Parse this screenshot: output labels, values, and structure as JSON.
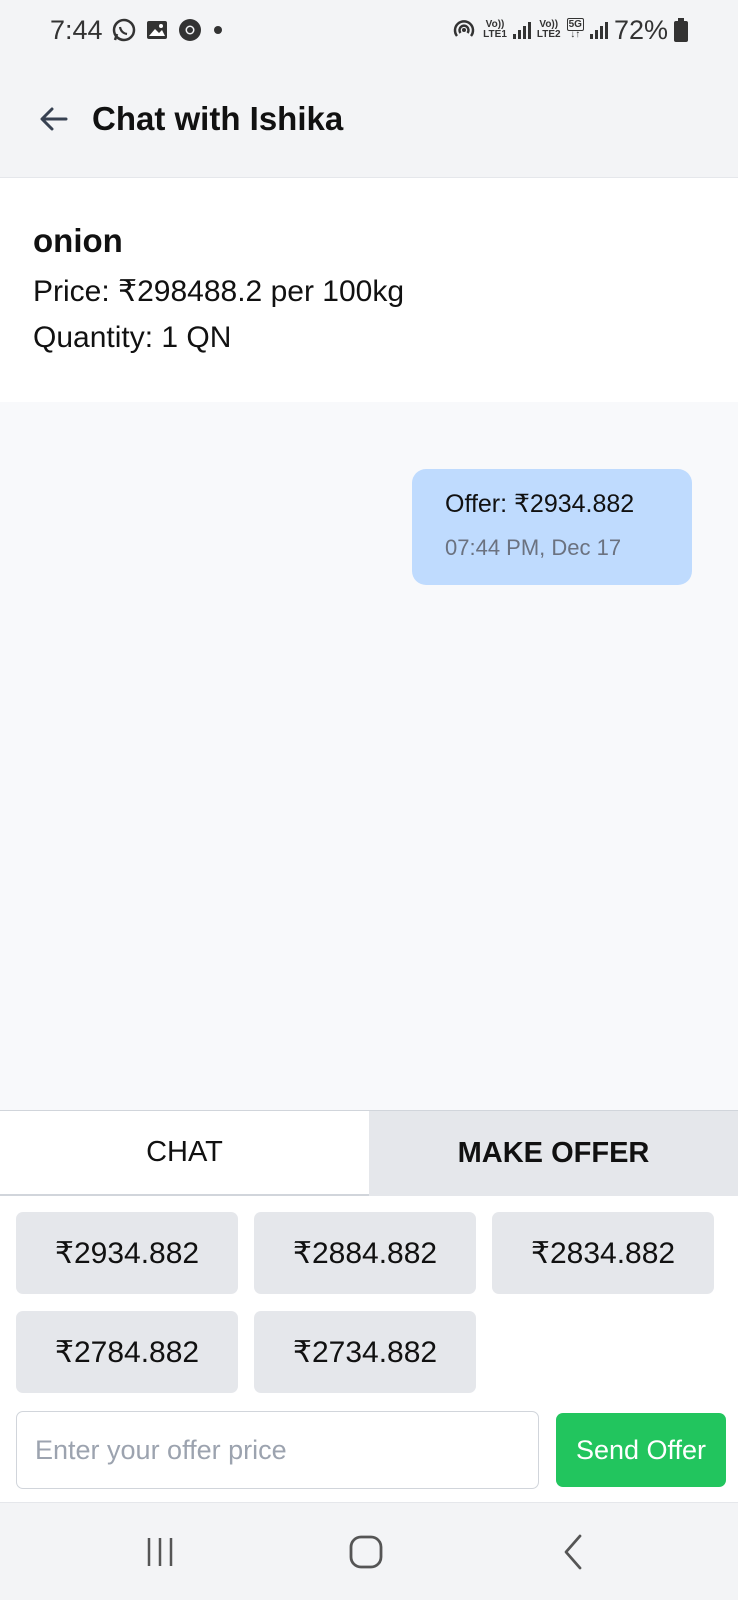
{
  "status_bar": {
    "time": "7:44",
    "battery": "72%",
    "sim1_label": "LTE1",
    "sim2_label": "LTE2",
    "network": "5G",
    "volte": "Vo))",
    "notification_icons": [
      "whatsapp-icon",
      "gallery-icon",
      "chrome-icon",
      "dot-icon"
    ]
  },
  "header": {
    "title": "Chat with Ishika"
  },
  "product": {
    "name": "onion",
    "price": "Price: ₹298488.2 per 100kg",
    "quantity": "Quantity: 1 QN"
  },
  "messages": [
    {
      "text": "Offer: ₹2934.882",
      "time": "07:44 PM, Dec 17"
    }
  ],
  "tabs": {
    "chat": "CHAT",
    "make_offer": "MAKE OFFER",
    "active": "make_offer"
  },
  "quick_offers": [
    "₹2934.882",
    "₹2884.882",
    "₹2834.882",
    "₹2784.882",
    "₹2734.882"
  ],
  "offer_form": {
    "placeholder": "Enter your offer price",
    "value": "",
    "send_label": "Send Offer"
  },
  "colors": {
    "bubble": "#bfdbfe",
    "send_button": "#22c55e",
    "quick_offer_bg": "#e5e7eb",
    "active_tab_bg": "#e5e7eb"
  }
}
